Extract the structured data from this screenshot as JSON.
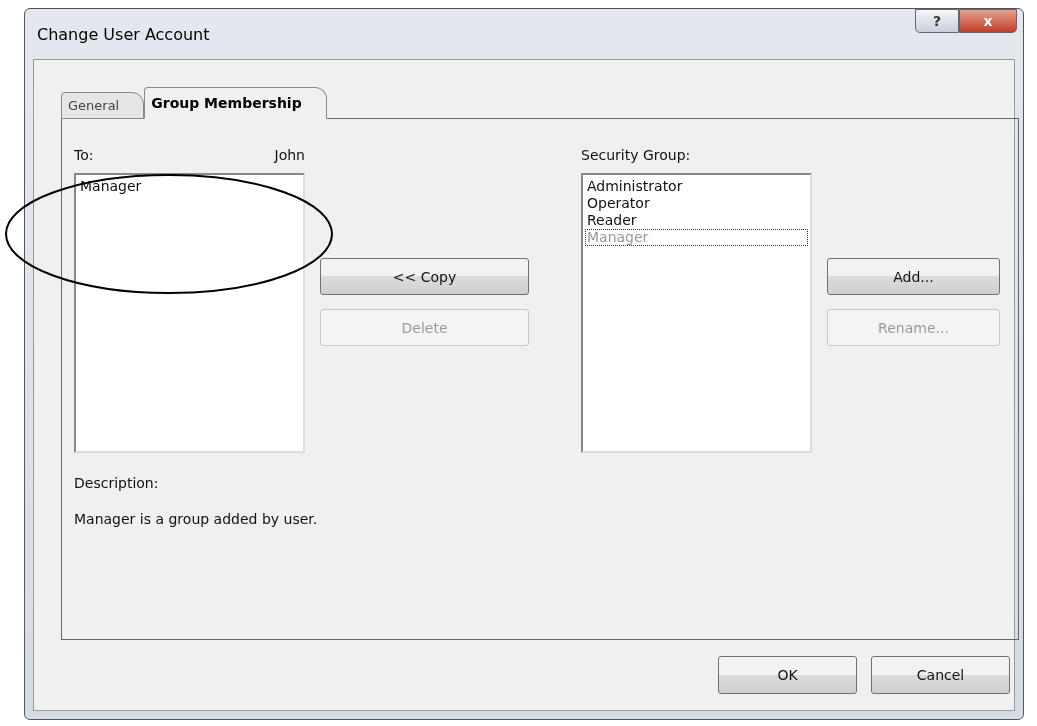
{
  "window": {
    "title": "Change User Account",
    "help_button": "?",
    "close_button": "x"
  },
  "tabs": [
    {
      "label": "General",
      "selected": false
    },
    {
      "label": "Group Membership",
      "selected": true
    }
  ],
  "member_list": {
    "label": "To:",
    "user": "John",
    "items": [
      {
        "label": "Manager",
        "selected": false
      }
    ]
  },
  "member_buttons": [
    {
      "label": "<< Copy",
      "disabled": false
    },
    {
      "label": "Delete",
      "disabled": true
    }
  ],
  "group_list": {
    "label": "Security Group:",
    "items": [
      {
        "label": "Administrator",
        "disabled": false,
        "focused": false
      },
      {
        "label": "Operator",
        "disabled": false,
        "focused": false
      },
      {
        "label": "Reader",
        "disabled": false,
        "focused": false
      },
      {
        "label": "Manager",
        "disabled": true,
        "focused": true
      }
    ]
  },
  "group_buttons": [
    {
      "label": "Add...",
      "disabled": false
    },
    {
      "label": "Rename...",
      "disabled": true
    }
  ],
  "description": {
    "label": "Description:",
    "text": "Manager is a group added by user."
  },
  "dialog_buttons": [
    {
      "label": "OK"
    },
    {
      "label": "Cancel"
    }
  ]
}
